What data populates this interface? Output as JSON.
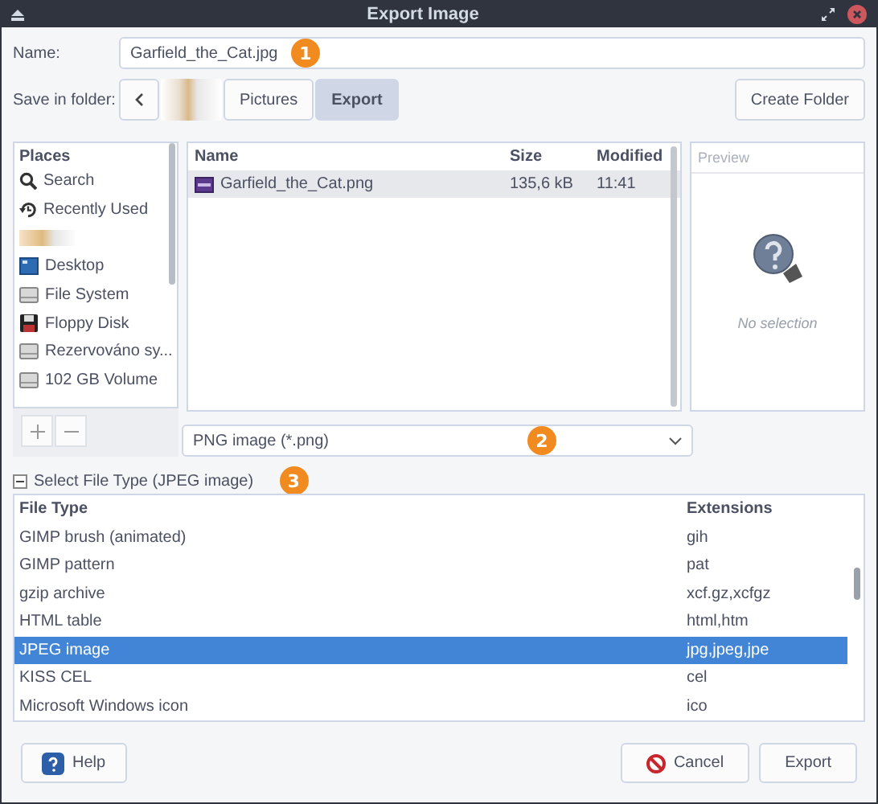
{
  "window": {
    "title": "Export Image"
  },
  "name_field": {
    "label": "Name:",
    "value": "Garfield_the_Cat.jpg",
    "badge": "1"
  },
  "folder": {
    "label": "Save in folder:",
    "path": [
      {
        "kind": "redacted",
        "selected": false
      },
      {
        "kind": "folder",
        "label": "Pictures",
        "selected": false
      },
      {
        "kind": "folder",
        "label": "Export",
        "selected": true
      }
    ],
    "create_button": "Create Folder"
  },
  "places": {
    "title": "Places",
    "items": [
      {
        "kind": "search",
        "label": "Search"
      },
      {
        "kind": "recent",
        "label": "Recently Used"
      },
      {
        "kind": "redacted"
      },
      {
        "kind": "desktop",
        "label": "Desktop"
      },
      {
        "kind": "drive",
        "label": "File System"
      },
      {
        "kind": "floppy",
        "label": "Floppy Disk"
      },
      {
        "kind": "drive",
        "label": "Rezervováno sy..."
      },
      {
        "kind": "drive",
        "label": "102 GB Volume"
      }
    ]
  },
  "files": {
    "columns": [
      "Name",
      "Size",
      "Modified"
    ],
    "rows": [
      {
        "name": "Garfield_the_Cat.png",
        "size": "135,6 kB",
        "modified": "11:41"
      }
    ]
  },
  "preview": {
    "title": "Preview",
    "text": "No selection"
  },
  "filter": {
    "value": "PNG image (*.png)",
    "badge": "2"
  },
  "file_type": {
    "label": "Select File Type (JPEG image)",
    "expanded": true,
    "badge": "3",
    "columns": [
      "File Type",
      "Extensions"
    ],
    "rows": [
      {
        "type": "GIMP brush (animated)",
        "extensions": "gih",
        "selected": false
      },
      {
        "type": "GIMP pattern",
        "extensions": "pat",
        "selected": false
      },
      {
        "type": "gzip archive",
        "extensions": "xcf.gz,xcfgz",
        "selected": false
      },
      {
        "type": "HTML table",
        "extensions": "html,htm",
        "selected": false
      },
      {
        "type": "JPEG image",
        "extensions": "jpg,jpeg,jpe",
        "selected": true
      },
      {
        "type": "KISS CEL",
        "extensions": "cel",
        "selected": false
      },
      {
        "type": "Microsoft Windows icon",
        "extensions": "ico",
        "selected": false
      }
    ]
  },
  "buttons": [
    {
      "kind": "help",
      "label": "Help"
    },
    {
      "kind": "cancel",
      "label": "Cancel"
    },
    {
      "kind": "plain",
      "label": "Export"
    }
  ]
}
